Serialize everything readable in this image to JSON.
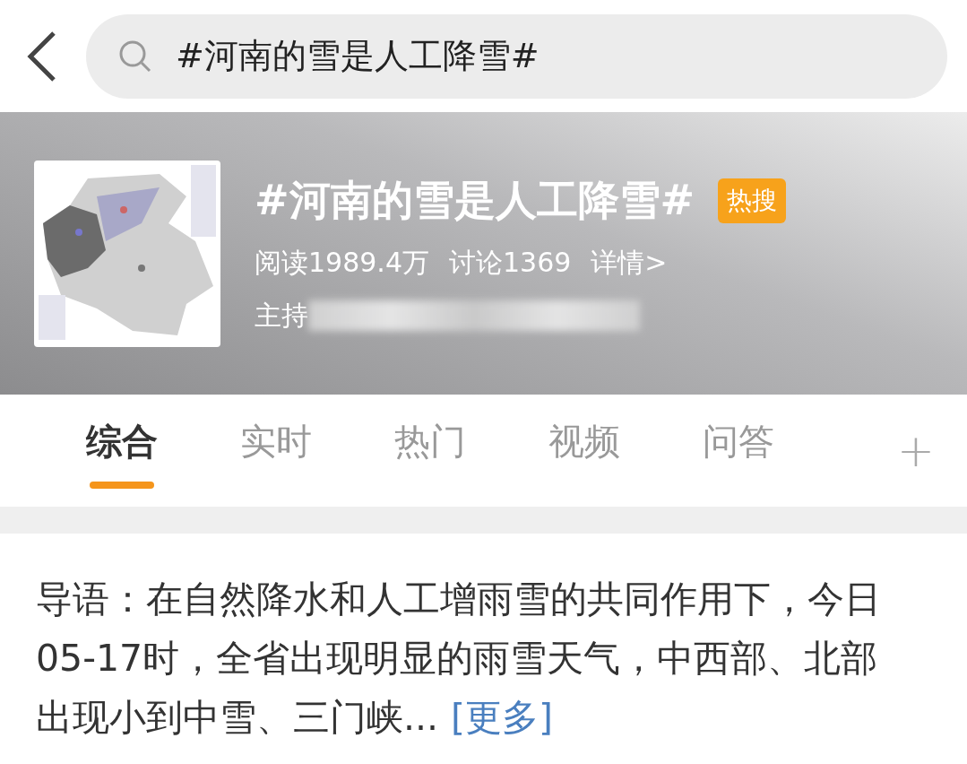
{
  "search": {
    "value": "#河南的雪是人工降雪#"
  },
  "topic": {
    "title": "#河南的雪是人工降雪#",
    "badge": "热搜",
    "reads": "阅读1989.4万",
    "discussions": "讨论1369",
    "details": "详情>",
    "host_label": "主持",
    "host_redacted": true
  },
  "tabs": [
    {
      "label": "综合",
      "selected": true
    },
    {
      "label": "实时",
      "selected": false
    },
    {
      "label": "热门",
      "selected": false
    },
    {
      "label": "视频",
      "selected": false
    },
    {
      "label": "问答",
      "selected": false
    }
  ],
  "add_tab": "+",
  "intro": {
    "text": "导语：在自然降水和人工增雨雪的共同作用下，今日05-17时，全省出现明显的雨雪天气，中西部、北部出现小到中雪、三门峡...",
    "more": "[更多]"
  }
}
